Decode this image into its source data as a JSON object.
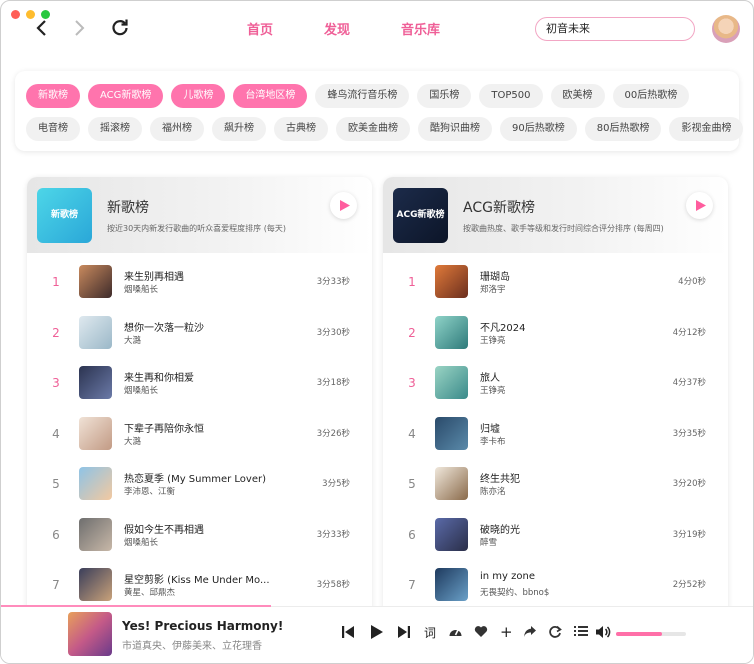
{
  "colors": {
    "accent": "#ef5f97",
    "tag_active": "#ff74ad",
    "close": "#ff5f57",
    "minimize": "#febc2e",
    "maximize": "#28c840"
  },
  "nav": {
    "back_icon": "chevron-left-icon",
    "forward_icon": "chevron-right-icon",
    "refresh_icon": "refresh-icon",
    "tabs": [
      "首页",
      "发现",
      "音乐库"
    ]
  },
  "search": {
    "value": "初音未来"
  },
  "tags": {
    "row1": [
      {
        "label": "新歌榜",
        "active": true
      },
      {
        "label": "ACG新歌榜",
        "active": true
      },
      {
        "label": "儿歌榜",
        "active": true
      },
      {
        "label": "台湾地区榜",
        "active": true
      },
      {
        "label": "蜂鸟流行音乐榜",
        "active": false
      },
      {
        "label": "国乐榜",
        "active": false
      },
      {
        "label": "TOP500",
        "active": false
      },
      {
        "label": "欧美榜",
        "active": false
      },
      {
        "label": "00后热歌榜",
        "active": false
      }
    ],
    "row2": [
      {
        "label": "电音榜",
        "active": false
      },
      {
        "label": "摇滚榜",
        "active": false
      },
      {
        "label": "福州榜",
        "active": false
      },
      {
        "label": "飙升榜",
        "active": false
      },
      {
        "label": "古典榜",
        "active": false
      },
      {
        "label": "欧美金曲榜",
        "active": false
      },
      {
        "label": "酷狗识曲榜",
        "active": false
      },
      {
        "label": "90后热歌榜",
        "active": false
      },
      {
        "label": "80后热歌榜",
        "active": false
      },
      {
        "label": "影视金曲榜",
        "active": false
      }
    ]
  },
  "charts": [
    {
      "title": "新歌榜",
      "cover_text": "新歌榜",
      "desc": "按近30天内新发行歌曲的听众喜爱程度排序 (每天)",
      "songs": [
        {
          "rank": "1",
          "title": "来生别再相遇",
          "artist": "烟嗓船长",
          "duration": "3分33秒"
        },
        {
          "rank": "2",
          "title": "想你一次落一粒沙",
          "artist": "大潞",
          "duration": "3分30秒"
        },
        {
          "rank": "3",
          "title": "来生再和你相爱",
          "artist": "烟嗓船长",
          "duration": "3分18秒"
        },
        {
          "rank": "4",
          "title": "下辈子再陪你永恒",
          "artist": "大潞",
          "duration": "3分26秒"
        },
        {
          "rank": "5",
          "title": "热恋夏季 (My Summer Lover)",
          "artist": "李沛恩、江衡",
          "duration": "3分5秒"
        },
        {
          "rank": "6",
          "title": "假如今生不再相遇",
          "artist": "烟嗓船长",
          "duration": "3分33秒"
        },
        {
          "rank": "7",
          "title": "星空剪影 (Kiss Me Under Mo...",
          "artist": "黄星、邱鼎杰",
          "duration": "3分58秒"
        }
      ]
    },
    {
      "title": "ACG新歌榜",
      "cover_text": "ACG新歌榜",
      "desc": "按歌曲热度、歌手等级和发行时间综合评分排序 (每周四)",
      "songs": [
        {
          "rank": "1",
          "title": "珊瑚岛",
          "artist": "郑洛宇",
          "duration": "4分0秒"
        },
        {
          "rank": "2",
          "title": "不凡2024",
          "artist": "王铮亮",
          "duration": "4分12秒"
        },
        {
          "rank": "3",
          "title": "旅人",
          "artist": "王铮亮",
          "duration": "4分37秒"
        },
        {
          "rank": "4",
          "title": "归墟",
          "artist": "李卡布",
          "duration": "3分35秒"
        },
        {
          "rank": "5",
          "title": "终生共犯",
          "artist": "陈亦洺",
          "duration": "3分20秒"
        },
        {
          "rank": "6",
          "title": "破晓的光",
          "artist": "醉雪",
          "duration": "3分19秒"
        },
        {
          "rank": "7",
          "title": "in my zone",
          "artist": "无畏契约、bbno$",
          "duration": "2分52秒"
        }
      ]
    }
  ],
  "player": {
    "title": "Yes! Precious Harmony!",
    "artist": "市道真央、伊藤美来、立花理香",
    "lyrics_label": "词",
    "volume": 0.65
  }
}
